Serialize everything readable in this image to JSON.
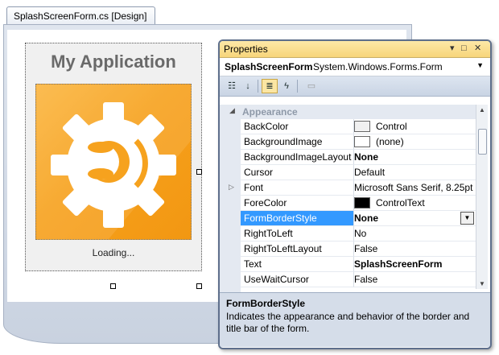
{
  "document": {
    "tab_title": "SplashScreenForm.cs [Design]"
  },
  "splash": {
    "title": "My Application",
    "loading_text": "Loading...",
    "image_icon": "gear-icon"
  },
  "properties": {
    "window_title": "Properties",
    "titlebar_buttons": [
      "pin-dropdown-icon",
      "maximize-icon",
      "close-icon"
    ],
    "object_name": "SplashScreenForm",
    "object_type": "System.Windows.Forms.Form",
    "toolbar": [
      "categorized-icon",
      "alphabetical-icon",
      "properties-icon",
      "events-icon",
      "property-pages-icon"
    ],
    "category": "Appearance",
    "rows": [
      {
        "name": "BackColor",
        "value": "Control",
        "swatch": "#f0f0f0"
      },
      {
        "name": "BackgroundImage",
        "value": "(none)",
        "swatch": "#ffffff"
      },
      {
        "name": "BackgroundImageLayout",
        "value": "None",
        "bold": true
      },
      {
        "name": "Cursor",
        "value": "Default"
      },
      {
        "name": "Font",
        "value": "Microsoft Sans Serif, 8.25pt",
        "expandable": true
      },
      {
        "name": "ForeColor",
        "value": "ControlText",
        "swatch": "#000000"
      },
      {
        "name": "FormBorderStyle",
        "value": "None",
        "bold": true,
        "selected": true
      },
      {
        "name": "RightToLeft",
        "value": "No"
      },
      {
        "name": "RightToLeftLayout",
        "value": "False"
      },
      {
        "name": "Text",
        "value": "SplashScreenForm",
        "bold": true
      },
      {
        "name": "UseWaitCursor",
        "value": "False"
      }
    ],
    "description": {
      "title": "FormBorderStyle",
      "text": "Indicates the appearance and behavior of the border and title bar of the form."
    },
    "colors": {
      "selection": "#3399ff",
      "titlebar": "#f7d57a"
    }
  }
}
